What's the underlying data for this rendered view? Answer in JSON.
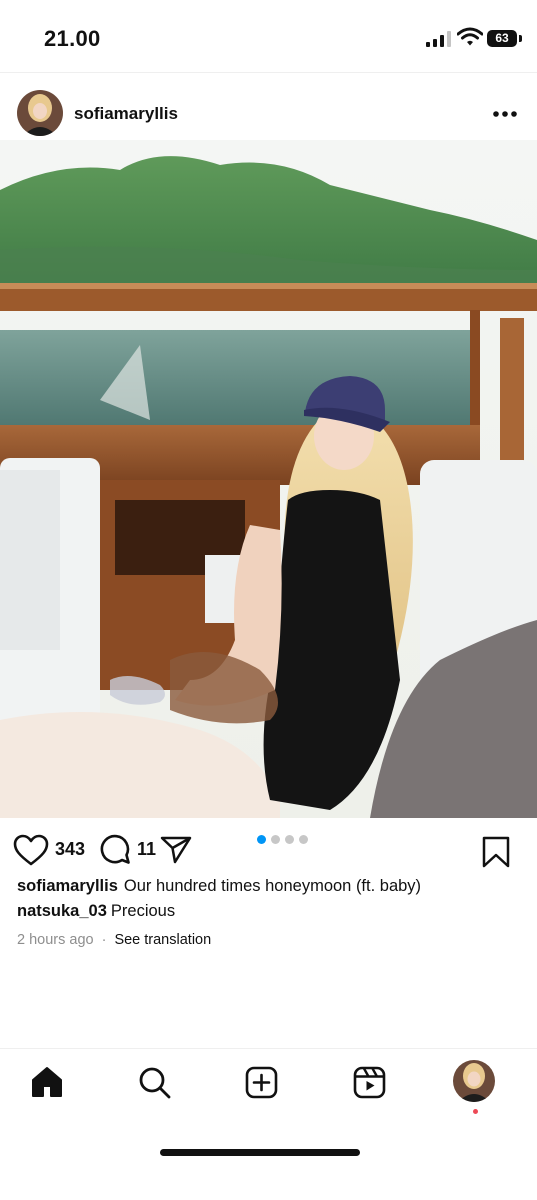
{
  "status_bar": {
    "time": "21.00",
    "battery": "63"
  },
  "post": {
    "username": "sofiamaryllis",
    "likes": "343",
    "comments": "11",
    "carousel": {
      "total": 4,
      "active": 1
    },
    "caption_username": "sofiamaryllis",
    "caption_text": "Our hundred times honeymoon (ft. baby)",
    "comment_username": "natsuka_03",
    "comment_text": "Precious",
    "time_ago": "2 hours ago",
    "separator": "·",
    "see_translation": "See translation"
  },
  "icons": {
    "more": "more-horizontal-icon",
    "like": "heart-icon",
    "comment": "comment-bubble-icon",
    "share": "paper-plane-icon",
    "save": "bookmark-icon",
    "home": "home-icon",
    "search": "search-icon",
    "create": "plus-square-icon",
    "reels": "reels-icon"
  },
  "colors": {
    "accent": "#0095f6",
    "notification": "#ed4956",
    "muted": "#8e8e8e"
  }
}
